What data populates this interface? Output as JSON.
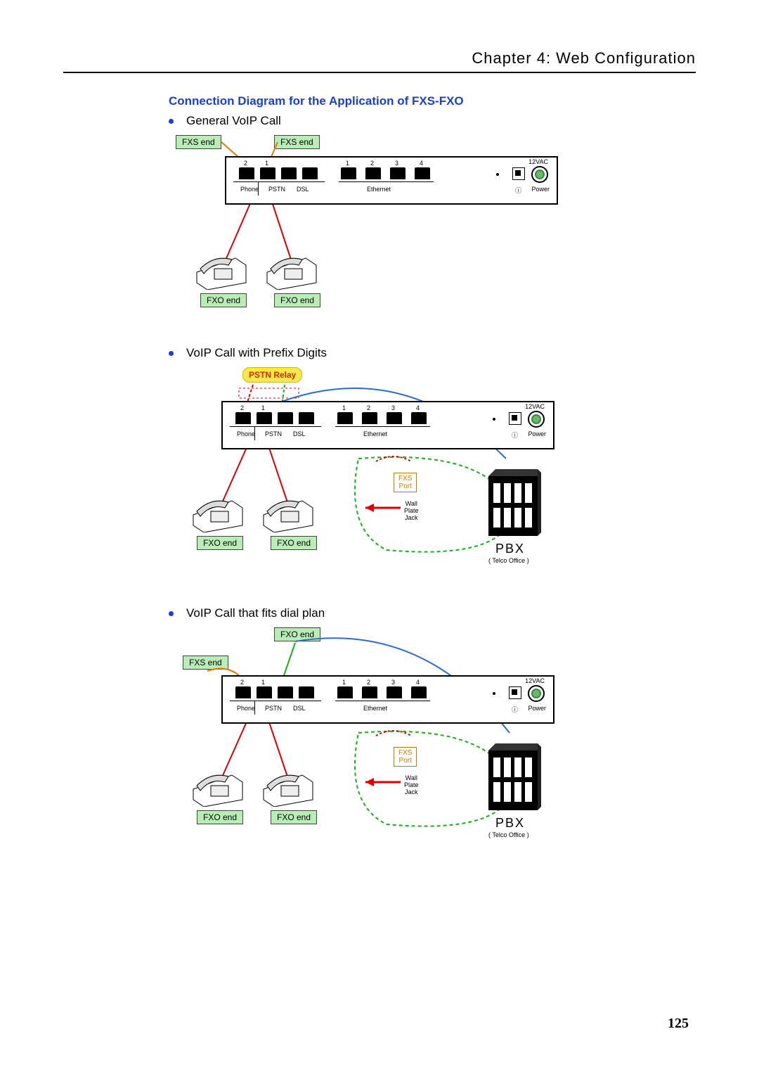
{
  "header": {
    "chapter": "Chapter 4: Web Configuration"
  },
  "section": {
    "title": "Connection Diagram for the Application of FXS-FXO"
  },
  "bullets": {
    "b1": "General VoIP Call",
    "b2": "VoIP Call with Prefix Digits",
    "b3": "VoIP Call that fits dial plan"
  },
  "labels": {
    "fxs_end": "FXS end",
    "fxo_end": "FXO end",
    "pstn_relay": "PSTN Relay",
    "fxs_port": "FXS\nPort",
    "wall_plate": "Wall\nPlate\nJack",
    "pbx": "PBX",
    "pbx_sub": "( Telco Office )",
    "phone": "Phone",
    "pstn": "PSTN",
    "dsl": "DSL",
    "ethernet": "Ethernet",
    "power": "Power",
    "v12": "12VAC",
    "n1": "1",
    "n2": "2",
    "n3": "3",
    "n4": "4"
  },
  "page_number": "125"
}
